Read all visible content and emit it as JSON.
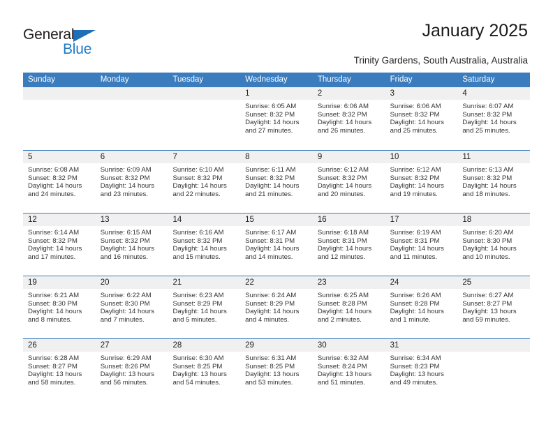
{
  "logo": {
    "word_dark": "General",
    "word_blue": "Blue",
    "triangle_color": "#1f6fb8"
  },
  "header": {
    "title": "January 2025",
    "subtitle": "Trinity Gardens, South Australia, Australia"
  },
  "colors": {
    "header_blue": "#3a7cbe",
    "day_band_gray": "#f0f0f0",
    "text": "#222222"
  },
  "weekdays": [
    "Sunday",
    "Monday",
    "Tuesday",
    "Wednesday",
    "Thursday",
    "Friday",
    "Saturday"
  ],
  "labels": {
    "sunrise": "Sunrise:",
    "sunset": "Sunset:",
    "daylight": "Daylight:"
  },
  "weeks": [
    [
      {
        "day": "",
        "empty": true
      },
      {
        "day": "",
        "empty": true
      },
      {
        "day": "",
        "empty": true
      },
      {
        "day": "1",
        "sunrise": "Sunrise: 6:05 AM",
        "sunset": "Sunset: 8:32 PM",
        "daylight": "Daylight: 14 hours and 27 minutes."
      },
      {
        "day": "2",
        "sunrise": "Sunrise: 6:06 AM",
        "sunset": "Sunset: 8:32 PM",
        "daylight": "Daylight: 14 hours and 26 minutes."
      },
      {
        "day": "3",
        "sunrise": "Sunrise: 6:06 AM",
        "sunset": "Sunset: 8:32 PM",
        "daylight": "Daylight: 14 hours and 25 minutes."
      },
      {
        "day": "4",
        "sunrise": "Sunrise: 6:07 AM",
        "sunset": "Sunset: 8:32 PM",
        "daylight": "Daylight: 14 hours and 25 minutes."
      }
    ],
    [
      {
        "day": "5",
        "sunrise": "Sunrise: 6:08 AM",
        "sunset": "Sunset: 8:32 PM",
        "daylight": "Daylight: 14 hours and 24 minutes."
      },
      {
        "day": "6",
        "sunrise": "Sunrise: 6:09 AM",
        "sunset": "Sunset: 8:32 PM",
        "daylight": "Daylight: 14 hours and 23 minutes."
      },
      {
        "day": "7",
        "sunrise": "Sunrise: 6:10 AM",
        "sunset": "Sunset: 8:32 PM",
        "daylight": "Daylight: 14 hours and 22 minutes."
      },
      {
        "day": "8",
        "sunrise": "Sunrise: 6:11 AM",
        "sunset": "Sunset: 8:32 PM",
        "daylight": "Daylight: 14 hours and 21 minutes."
      },
      {
        "day": "9",
        "sunrise": "Sunrise: 6:12 AM",
        "sunset": "Sunset: 8:32 PM",
        "daylight": "Daylight: 14 hours and 20 minutes."
      },
      {
        "day": "10",
        "sunrise": "Sunrise: 6:12 AM",
        "sunset": "Sunset: 8:32 PM",
        "daylight": "Daylight: 14 hours and 19 minutes."
      },
      {
        "day": "11",
        "sunrise": "Sunrise: 6:13 AM",
        "sunset": "Sunset: 8:32 PM",
        "daylight": "Daylight: 14 hours and 18 minutes."
      }
    ],
    [
      {
        "day": "12",
        "sunrise": "Sunrise: 6:14 AM",
        "sunset": "Sunset: 8:32 PM",
        "daylight": "Daylight: 14 hours and 17 minutes."
      },
      {
        "day": "13",
        "sunrise": "Sunrise: 6:15 AM",
        "sunset": "Sunset: 8:32 PM",
        "daylight": "Daylight: 14 hours and 16 minutes."
      },
      {
        "day": "14",
        "sunrise": "Sunrise: 6:16 AM",
        "sunset": "Sunset: 8:32 PM",
        "daylight": "Daylight: 14 hours and 15 minutes."
      },
      {
        "day": "15",
        "sunrise": "Sunrise: 6:17 AM",
        "sunset": "Sunset: 8:31 PM",
        "daylight": "Daylight: 14 hours and 14 minutes."
      },
      {
        "day": "16",
        "sunrise": "Sunrise: 6:18 AM",
        "sunset": "Sunset: 8:31 PM",
        "daylight": "Daylight: 14 hours and 12 minutes."
      },
      {
        "day": "17",
        "sunrise": "Sunrise: 6:19 AM",
        "sunset": "Sunset: 8:31 PM",
        "daylight": "Daylight: 14 hours and 11 minutes."
      },
      {
        "day": "18",
        "sunrise": "Sunrise: 6:20 AM",
        "sunset": "Sunset: 8:30 PM",
        "daylight": "Daylight: 14 hours and 10 minutes."
      }
    ],
    [
      {
        "day": "19",
        "sunrise": "Sunrise: 6:21 AM",
        "sunset": "Sunset: 8:30 PM",
        "daylight": "Daylight: 14 hours and 8 minutes."
      },
      {
        "day": "20",
        "sunrise": "Sunrise: 6:22 AM",
        "sunset": "Sunset: 8:30 PM",
        "daylight": "Daylight: 14 hours and 7 minutes."
      },
      {
        "day": "21",
        "sunrise": "Sunrise: 6:23 AM",
        "sunset": "Sunset: 8:29 PM",
        "daylight": "Daylight: 14 hours and 5 minutes."
      },
      {
        "day": "22",
        "sunrise": "Sunrise: 6:24 AM",
        "sunset": "Sunset: 8:29 PM",
        "daylight": "Daylight: 14 hours and 4 minutes."
      },
      {
        "day": "23",
        "sunrise": "Sunrise: 6:25 AM",
        "sunset": "Sunset: 8:28 PM",
        "daylight": "Daylight: 14 hours and 2 minutes."
      },
      {
        "day": "24",
        "sunrise": "Sunrise: 6:26 AM",
        "sunset": "Sunset: 8:28 PM",
        "daylight": "Daylight: 14 hours and 1 minute."
      },
      {
        "day": "25",
        "sunrise": "Sunrise: 6:27 AM",
        "sunset": "Sunset: 8:27 PM",
        "daylight": "Daylight: 13 hours and 59 minutes."
      }
    ],
    [
      {
        "day": "26",
        "sunrise": "Sunrise: 6:28 AM",
        "sunset": "Sunset: 8:27 PM",
        "daylight": "Daylight: 13 hours and 58 minutes."
      },
      {
        "day": "27",
        "sunrise": "Sunrise: 6:29 AM",
        "sunset": "Sunset: 8:26 PM",
        "daylight": "Daylight: 13 hours and 56 minutes."
      },
      {
        "day": "28",
        "sunrise": "Sunrise: 6:30 AM",
        "sunset": "Sunset: 8:25 PM",
        "daylight": "Daylight: 13 hours and 54 minutes."
      },
      {
        "day": "29",
        "sunrise": "Sunrise: 6:31 AM",
        "sunset": "Sunset: 8:25 PM",
        "daylight": "Daylight: 13 hours and 53 minutes."
      },
      {
        "day": "30",
        "sunrise": "Sunrise: 6:32 AM",
        "sunset": "Sunset: 8:24 PM",
        "daylight": "Daylight: 13 hours and 51 minutes."
      },
      {
        "day": "31",
        "sunrise": "Sunrise: 6:34 AM",
        "sunset": "Sunset: 8:23 PM",
        "daylight": "Daylight: 13 hours and 49 minutes."
      },
      {
        "day": "",
        "empty": true
      }
    ]
  ]
}
